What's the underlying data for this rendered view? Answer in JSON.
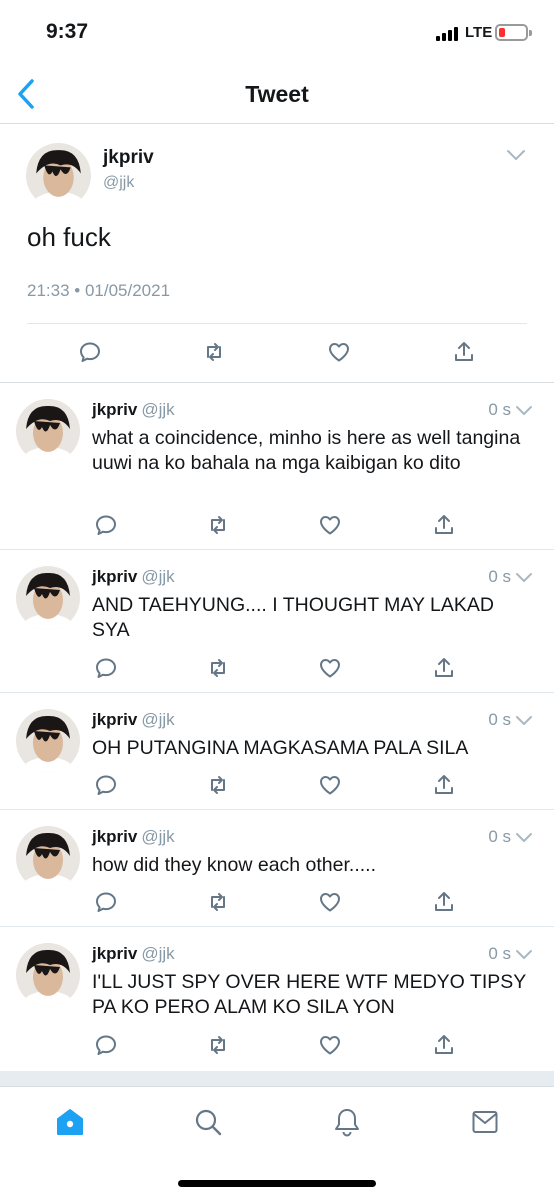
{
  "status_bar": {
    "time": "9:37",
    "network": "LTE"
  },
  "nav": {
    "title": "Tweet"
  },
  "main_tweet": {
    "name": "jkpriv",
    "handle": "@jjk",
    "text": "oh fuck",
    "meta": "21:33 • 01/05/2021"
  },
  "replies": [
    {
      "name": "jkpriv",
      "handle": "@jjk",
      "time": "0 s",
      "text": "what a coincidence, minho is here as well tangina uuwi na ko bahala na mga kaibigan ko dito"
    },
    {
      "name": "jkpriv",
      "handle": "@jjk",
      "time": "0 s",
      "text": "AND TAEHYUNG.... I THOUGHT MAY LAKAD SYA"
    },
    {
      "name": "jkpriv",
      "handle": "@jjk",
      "time": "0 s",
      "text": "OH PUTANGINA MAGKASAMA PALA SILA"
    },
    {
      "name": "jkpriv",
      "handle": "@jjk",
      "time": "0 s",
      "text": "how did they know each other....."
    },
    {
      "name": "jkpriv",
      "handle": "@jjk",
      "time": "0 s",
      "text": "I'LL JUST SPY OVER HERE WTF MEDYO TIPSY PA KO PERO ALAM KO SILA YON"
    }
  ],
  "colors": {
    "accent": "#1da1f2",
    "icon_gray": "#657786",
    "text_gray": "#8899a6",
    "battery_low": "#ff2d2d"
  },
  "icons": [
    "back-chevron",
    "caret-down",
    "reply",
    "retweet",
    "like",
    "share",
    "home",
    "search",
    "notifications",
    "messages"
  ]
}
